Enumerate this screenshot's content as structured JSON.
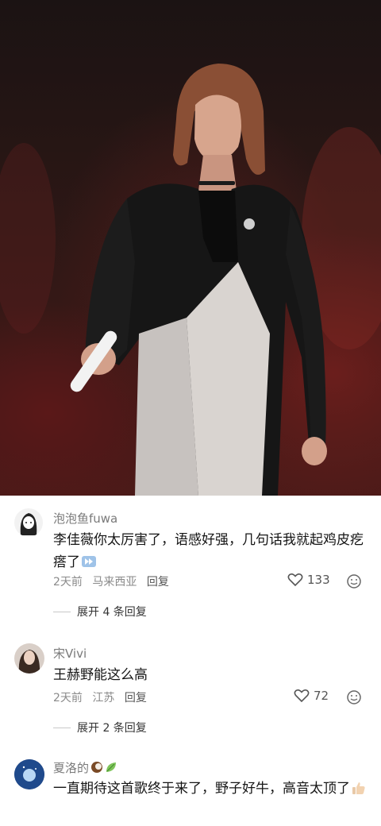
{
  "colors": {
    "meta_gray": "#8a8a8a",
    "name_gray": "#7a7a7a",
    "text": "#151515"
  },
  "comments": [
    {
      "username": "泡泡鱼fuwa",
      "text": "李佳薇你太厉害了，语感好强，几句话我就起鸡皮疙瘩了",
      "emoji_icon": "fast-forward-emoji-icon",
      "time": "2天前",
      "location": "马来西亚",
      "reply_label": "回复",
      "likes": "133",
      "expand_label": "展开 4 条回复"
    },
    {
      "username": "宋Vivi",
      "text": "王赫野能这么高",
      "time": "2天前",
      "location": "江苏",
      "reply_label": "回复",
      "likes": "72",
      "expand_label": "展开 2 条回复"
    },
    {
      "username": "夏洛的",
      "username_emojis": [
        "coconut-emoji-icon",
        "leaf-emoji-icon"
      ],
      "text": "一直期待这首歌终于来了，野子好牛，高音太顶了",
      "emoji_icon": "thumbs-up-emoji-icon"
    }
  ]
}
